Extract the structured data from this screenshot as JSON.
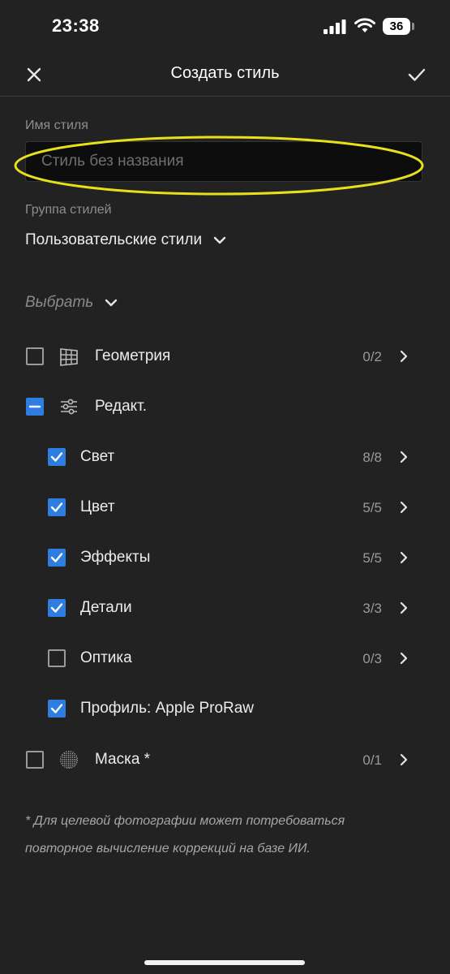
{
  "status_bar": {
    "time": "23:38",
    "battery": "36"
  },
  "header": {
    "title": "Создать стиль"
  },
  "form": {
    "name_label": "Имя стиля",
    "name_placeholder": "Стиль без названия",
    "group_label": "Группа стилей",
    "group_value": "Пользовательские стили",
    "select_label": "Выбрать"
  },
  "items": [
    {
      "label": "Геометрия",
      "count": "0/2",
      "state": "unchecked",
      "icon": "geometry-grid-icon",
      "has_arrow": true
    },
    {
      "label": "Редакт.",
      "count": "",
      "state": "mixed",
      "icon": "sliders-icon",
      "has_arrow": false
    },
    {
      "label": "Свет",
      "count": "8/8",
      "state": "checked",
      "has_arrow": true
    },
    {
      "label": "Цвет",
      "count": "5/5",
      "state": "checked",
      "has_arrow": true
    },
    {
      "label": "Эффекты",
      "count": "5/5",
      "state": "checked",
      "has_arrow": true
    },
    {
      "label": "Детали",
      "count": "3/3",
      "state": "checked",
      "has_arrow": true
    },
    {
      "label": "Оптика",
      "count": "0/3",
      "state": "unchecked",
      "has_arrow": true
    },
    {
      "label": "Профиль: Apple ProRaw",
      "count": "",
      "state": "checked",
      "has_arrow": false
    },
    {
      "label": "Маска *",
      "count": "0/1",
      "state": "unchecked",
      "icon": "mask-circle-icon",
      "has_arrow": true
    }
  ],
  "footnote": "* Для целевой фотографии может потребоваться повторное вычисление коррекций на базе ИИ.",
  "colors": {
    "accent": "#2d7ee0",
    "background": "#222222",
    "highlight": "#e8e01a"
  }
}
